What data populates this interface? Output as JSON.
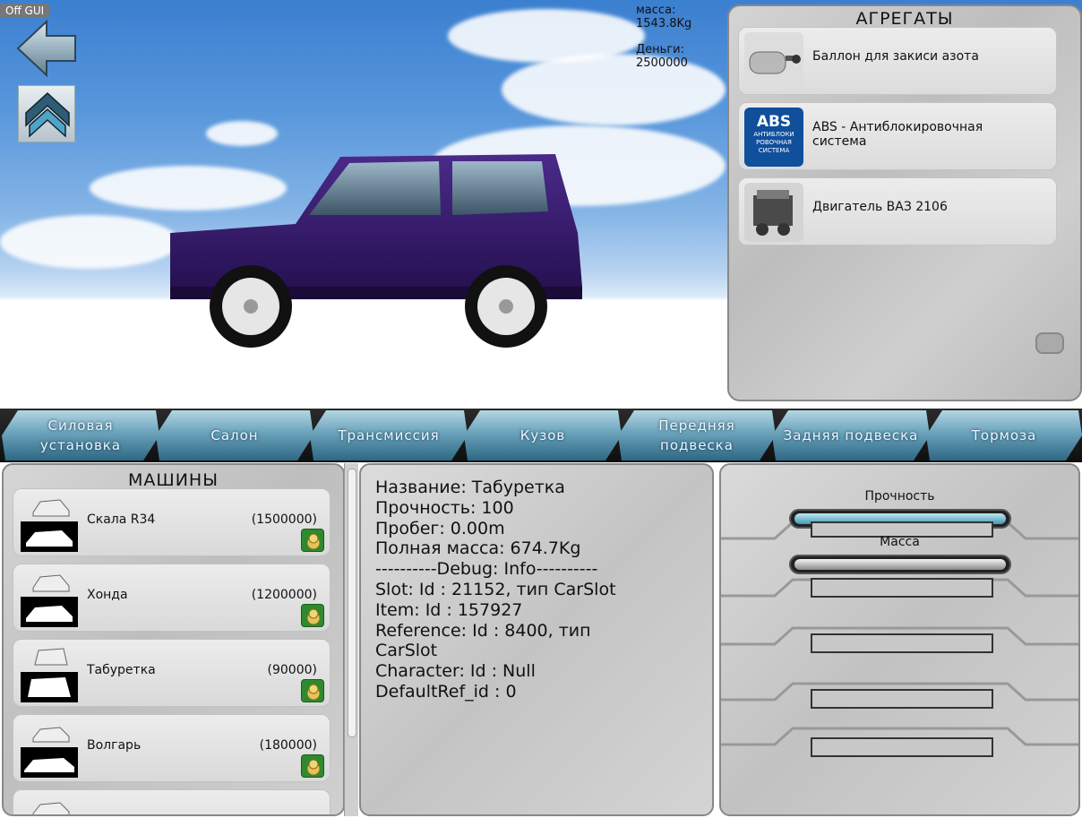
{
  "hud": {
    "off_gui": "Off GUI",
    "mass_label": "масса:",
    "mass_value": "1543.8Kg",
    "money_label": "Деньги:",
    "money_value": "2500000"
  },
  "aggregates": {
    "title": "АГРЕГАТЫ",
    "items": [
      {
        "label_l1": "Баллон для закиси азота",
        "label_l2": "",
        "icon": "nitrous-tank-icon"
      },
      {
        "label_l1": "ABS - Антиблокировочная",
        "label_l2": "система",
        "icon": "abs-icon",
        "badge": "ABS",
        "badge_sub": [
          "АНТИБЛОКИ",
          "РОВОЧНАЯ",
          "СИСТЕМА"
        ]
      },
      {
        "label_l1": "Двигатель ВАЗ 2106",
        "label_l2": "",
        "icon": "engine-icon"
      }
    ]
  },
  "tabs": [
    {
      "l1": "Силовая",
      "l2": "установка"
    },
    {
      "l1": "Салон",
      "l2": ""
    },
    {
      "l1": "Трансмиссия",
      "l2": ""
    },
    {
      "l1": "Кузов",
      "l2": ""
    },
    {
      "l1": "Передняя",
      "l2": "подвеска"
    },
    {
      "l1": "Задняя подвеска",
      "l2": ""
    },
    {
      "l1": "Тормоза",
      "l2": ""
    }
  ],
  "cars": {
    "title": "МАШИНЫ",
    "items": [
      {
        "name": "Скала R34",
        "price": "(1500000)"
      },
      {
        "name": "Хонда",
        "price": "(1200000)"
      },
      {
        "name": "Табуретка",
        "price": "(90000)"
      },
      {
        "name": "Волгарь",
        "price": "(180000)"
      }
    ]
  },
  "info": {
    "lines": [
      "Название: Табуретка",
      "Прочность: 100",
      "Пробег: 0.00m",
      "Полная масса: 674.7Kg",
      "----------Debug:  Info----------",
      "Slot: Id : 21152, тип CarSlot",
      "Item: Id : 157927",
      "Reference: Id : 8400, тип",
      "CarSlot",
      "Character: Id : Null",
      "DefaultRef_id : 0"
    ]
  },
  "bars": {
    "durability_label": "Прочность",
    "durability_level": 1.0,
    "mass_label": "Масса",
    "mass_level": 0.05
  },
  "colors": {
    "car_body": "#3a1c6e",
    "tab_accent": "#6aa2bb",
    "coin_bg": "#2e8a2e"
  }
}
